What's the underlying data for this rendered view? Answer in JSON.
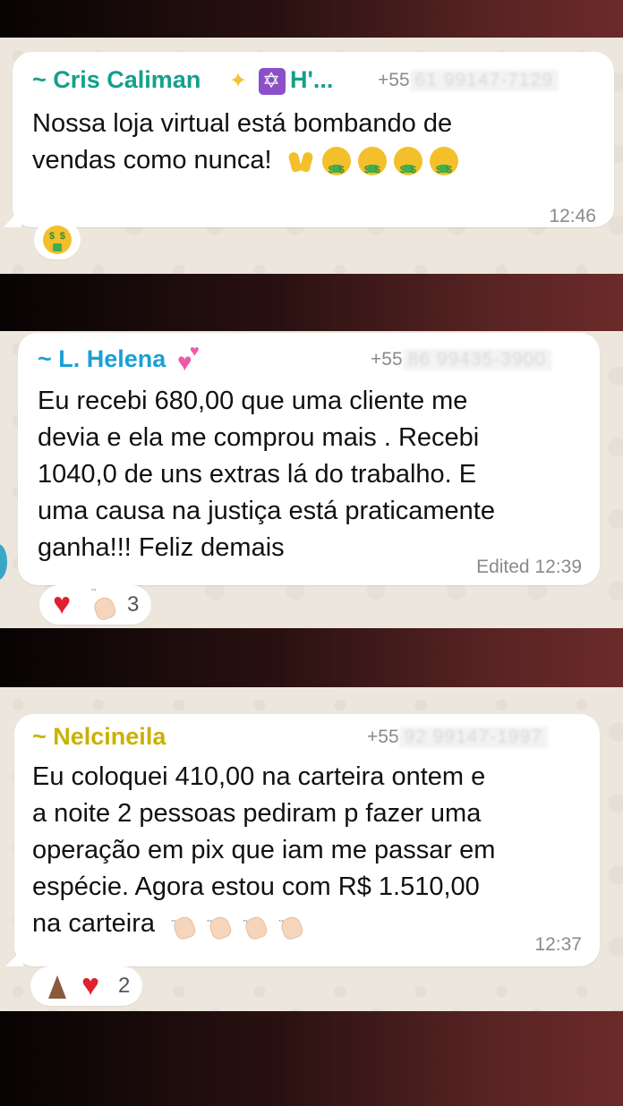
{
  "messages": [
    {
      "sender": "~ Cris Caliman",
      "sender_suffix": "H'...",
      "phone_prefix": "+55",
      "phone_hidden": "61 99147-7129",
      "text_lines": [
        "Nossa loja virtual está bombando de",
        "vendas como nunca!"
      ],
      "time": "12:46",
      "reaction_count": "",
      "sender_color": "#13a08b"
    },
    {
      "sender": "~ L. Helena",
      "phone_prefix": "+55",
      "phone_hidden": "86 99435-3900",
      "text_lines": [
        "Eu recebi 680,00 que uma cliente me",
        "devia e ela me comprou mais . Recebi",
        "1040,0 de uns extras lá do trabalho. E",
        "uma causa na justiça está praticamente",
        "ganha!!! Feliz demais"
      ],
      "time": "Edited 12:39",
      "reaction_count": "3",
      "sender_color": "#1a9fd6"
    },
    {
      "sender": "~ Nelcineila",
      "phone_prefix": "+55",
      "phone_hidden": "92 99147-1997",
      "text_lines": [
        "Eu coloquei 410,00 na carteira ontem e",
        "a noite 2 pessoas pediram p fazer uma",
        "operação em pix que iam me passar em",
        "espécie.  Agora estou com R$ 1.510,00",
        "na carteira"
      ],
      "time": "12:37",
      "reaction_count": "2",
      "sender_color": "#c9b100"
    }
  ]
}
